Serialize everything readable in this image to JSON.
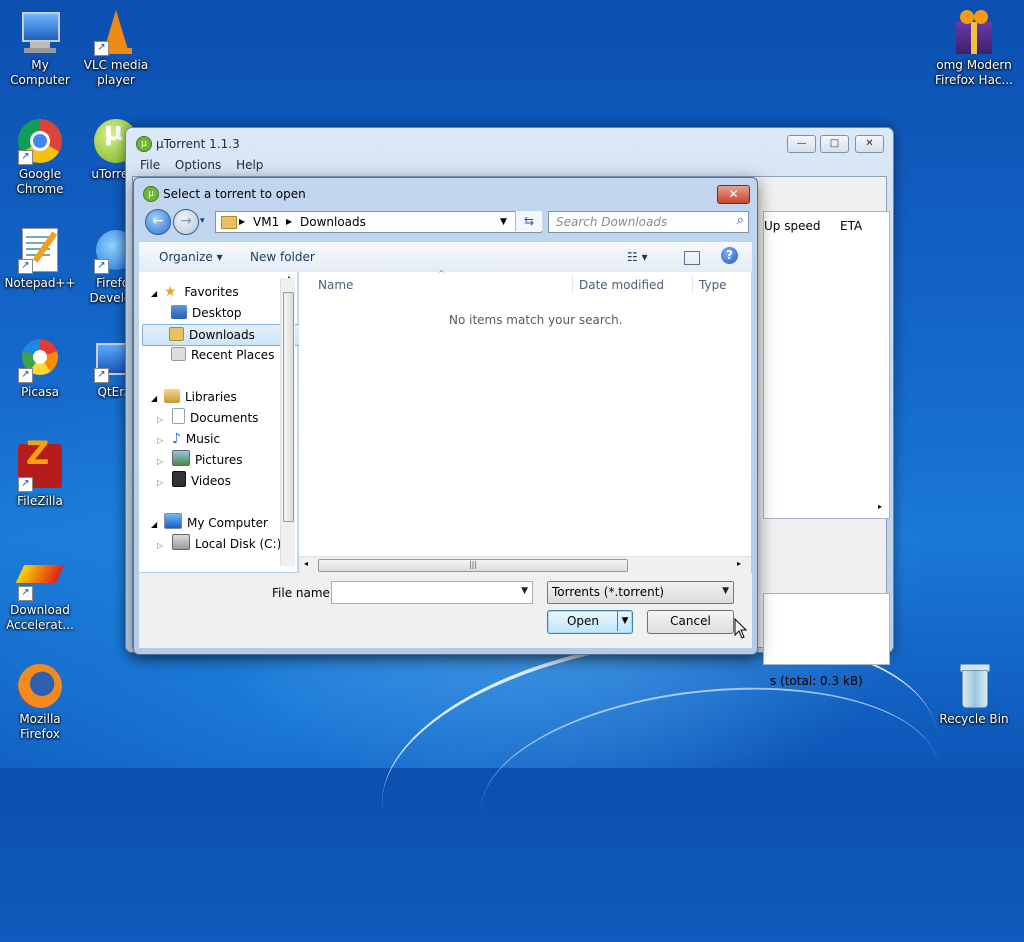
{
  "desktop": {
    "icons": [
      {
        "label": "My Computer",
        "icon": "computer-icon"
      },
      {
        "label": "VLC media player",
        "icon": "vlc-cone-icon"
      },
      {
        "label": "Google Chrome",
        "icon": "chrome-icon"
      },
      {
        "label": "uTorrent",
        "icon": "utorrent-icon"
      },
      {
        "label": "Notepad++",
        "icon": "notepad-icon"
      },
      {
        "label": "Firefox Develo...",
        "icon": "firefox-dev-icon"
      },
      {
        "label": "Picasa",
        "icon": "picasa-icon"
      },
      {
        "label": "QtEr...",
        "icon": "qt-icon"
      },
      {
        "label": "FileZilla",
        "icon": "filezilla-icon"
      },
      {
        "label": "Download Accelerat...",
        "icon": "download-accelerator-icon"
      },
      {
        "label": "Mozilla Firefox",
        "icon": "firefox-icon"
      },
      {
        "label": "omg Modern Firefox Hac...",
        "icon": "gift-box-icon"
      },
      {
        "label": "Recycle Bin",
        "icon": "recycle-bin-icon"
      }
    ]
  },
  "utorrent": {
    "title": "µTorrent 1.1.3",
    "menu": [
      "File",
      "Options",
      "Help"
    ],
    "columns": {
      "up_speed": "Up speed",
      "eta": "ETA"
    },
    "status": "s (total: 0.3 kB)"
  },
  "dialog": {
    "title": "Select a torrent to open",
    "breadcrumb": [
      "VM1",
      "Downloads"
    ],
    "search_placeholder": "Search Downloads",
    "toolbar": {
      "organize": "Organize ▾",
      "new_folder": "New folder"
    },
    "nav": {
      "favorites": "Favorites",
      "desktop": "Desktop",
      "downloads": "Downloads",
      "recent": "Recent Places",
      "libraries": "Libraries",
      "documents": "Documents",
      "music": "Music",
      "pictures": "Pictures",
      "videos": "Videos",
      "computer": "My Computer",
      "local_disk": "Local Disk (C:)"
    },
    "columns": {
      "name": "Name",
      "date_modified": "Date modified",
      "type": "Type"
    },
    "empty_message": "No items match your search.",
    "file_name_label": "File name:",
    "file_name_value": "",
    "file_type": "Torrents (*.torrent)",
    "open_label": "Open",
    "cancel_label": "Cancel"
  }
}
